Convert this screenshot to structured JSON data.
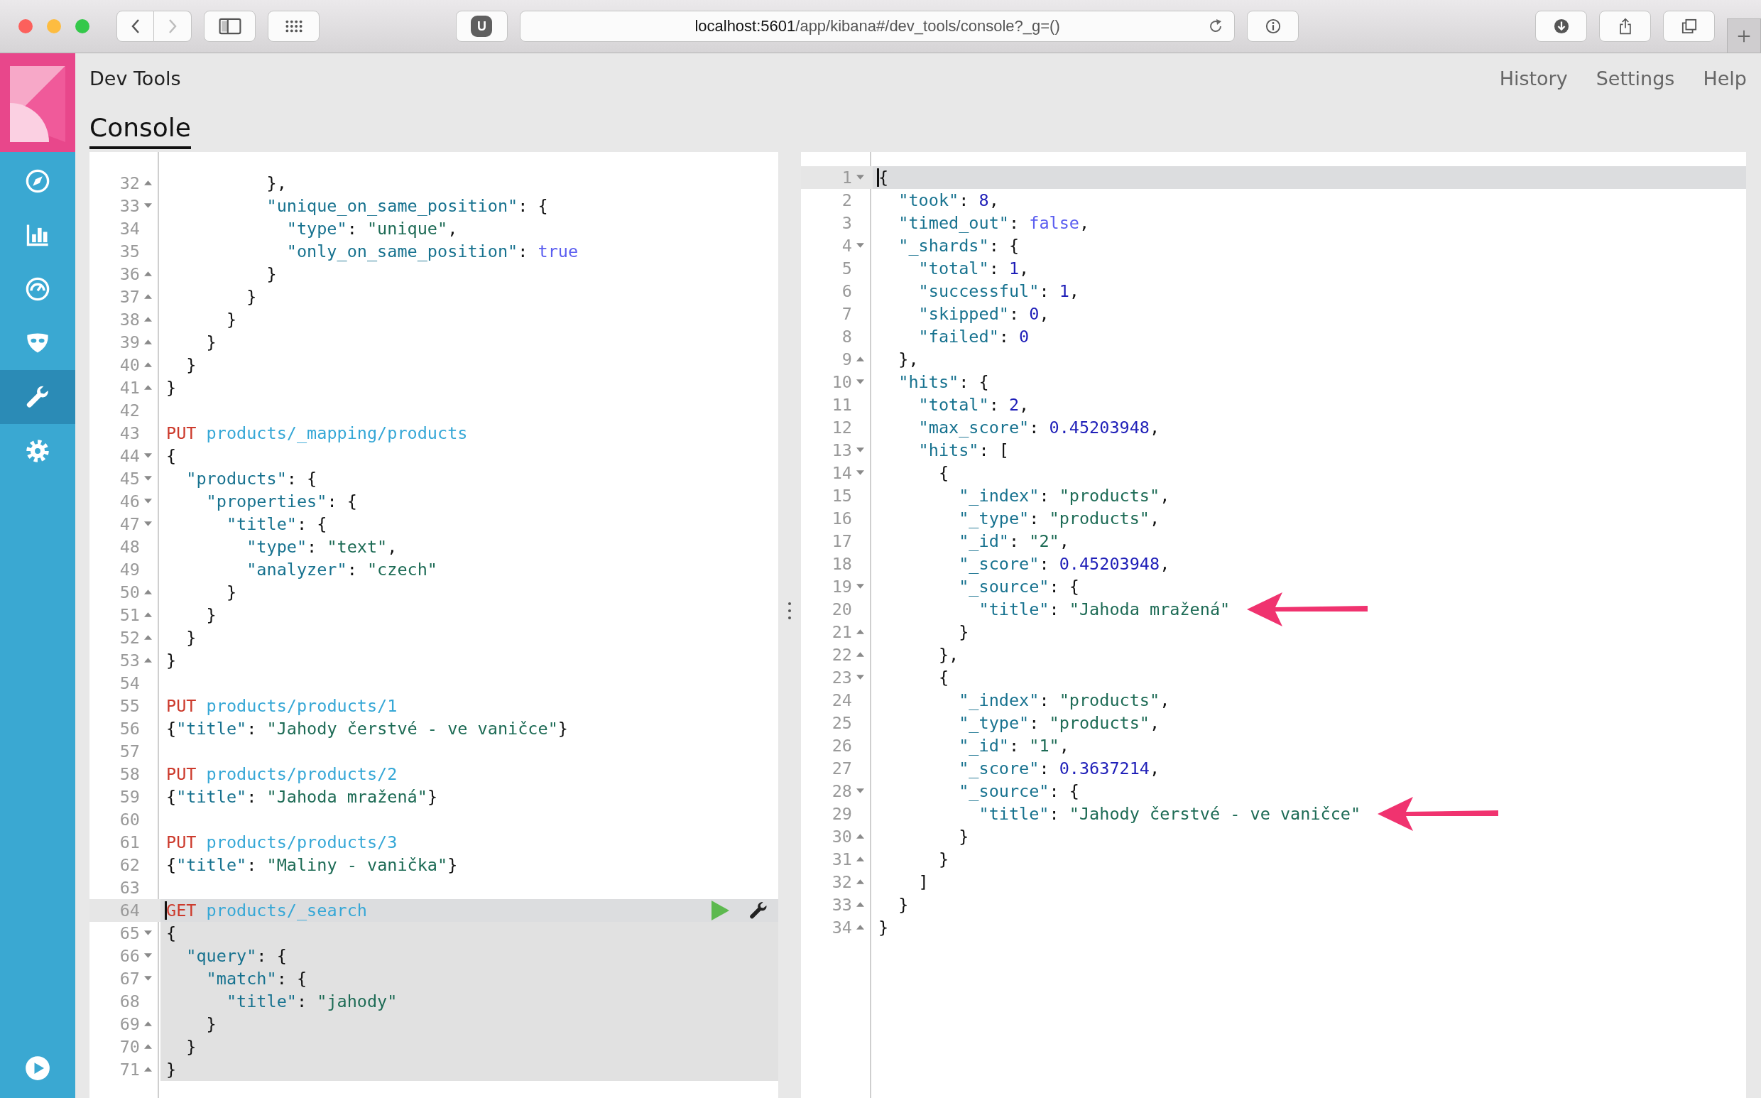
{
  "browser": {
    "back_disabled": false,
    "forward_disabled": true,
    "extension_badge": "U",
    "url_host": "localhost:5601",
    "url_path": "/app/kibana#/dev_tools/console?_g=()"
  },
  "sidebar": {
    "items": [
      {
        "kind": "compass",
        "selected": false
      },
      {
        "kind": "chart",
        "selected": false
      },
      {
        "kind": "gauge",
        "selected": false
      },
      {
        "kind": "mask",
        "selected": false
      },
      {
        "kind": "wrench",
        "selected": true
      },
      {
        "kind": "gear",
        "selected": false
      }
    ],
    "footer_item": {
      "kind": "play"
    }
  },
  "header": {
    "title": "Dev Tools",
    "links": [
      "History",
      "Settings",
      "Help"
    ]
  },
  "tabs": [
    {
      "label": "Console",
      "selected": true
    }
  ],
  "request_editor": {
    "lines": [
      {
        "number": "32",
        "kind": "fold_end",
        "selected": false,
        "in_request": false,
        "tokens": [
          {
            "kind": "punct",
            "text": "          },"
          }
        ]
      },
      {
        "number": "33",
        "kind": "fold_start",
        "selected": false,
        "in_request": false,
        "tokens": [
          {
            "kind": "key",
            "text": "          \"unique_on_same_position\""
          },
          {
            "kind": "punct",
            "text": ": {"
          }
        ]
      },
      {
        "number": "34",
        "kind": "plain",
        "selected": false,
        "in_request": false,
        "tokens": [
          {
            "kind": "key",
            "text": "            \"type\""
          },
          {
            "kind": "punct",
            "text": ": "
          },
          {
            "kind": "string",
            "text": "\"unique\""
          },
          {
            "kind": "punct",
            "text": ","
          }
        ]
      },
      {
        "number": "35",
        "kind": "plain",
        "selected": false,
        "in_request": false,
        "tokens": [
          {
            "kind": "key",
            "text": "            \"only_on_same_position\""
          },
          {
            "kind": "punct",
            "text": ": "
          },
          {
            "kind": "literal",
            "text": "true"
          }
        ]
      },
      {
        "number": "36",
        "kind": "fold_end",
        "selected": false,
        "in_request": false,
        "tokens": [
          {
            "kind": "punct",
            "text": "          }"
          }
        ]
      },
      {
        "number": "37",
        "kind": "fold_end",
        "selected": false,
        "in_request": false,
        "tokens": [
          {
            "kind": "punct",
            "text": "        }"
          }
        ]
      },
      {
        "number": "38",
        "kind": "fold_end",
        "selected": false,
        "in_request": false,
        "tokens": [
          {
            "kind": "punct",
            "text": "      }"
          }
        ]
      },
      {
        "number": "39",
        "kind": "fold_end",
        "selected": false,
        "in_request": false,
        "tokens": [
          {
            "kind": "punct",
            "text": "    }"
          }
        ]
      },
      {
        "number": "40",
        "kind": "fold_end",
        "selected": false,
        "in_request": false,
        "tokens": [
          {
            "kind": "punct",
            "text": "  }"
          }
        ]
      },
      {
        "number": "41",
        "kind": "fold_end",
        "selected": false,
        "in_request": false,
        "tokens": [
          {
            "kind": "punct",
            "text": "}"
          }
        ]
      },
      {
        "number": "42",
        "kind": "plain",
        "selected": false,
        "in_request": false
      },
      {
        "number": "43",
        "kind": "plain",
        "selected": false,
        "in_request": false,
        "tokens": [
          {
            "kind": "method",
            "text": "PUT"
          },
          {
            "kind": "path",
            "text": " products/_mapping/products"
          }
        ]
      },
      {
        "number": "44",
        "kind": "fold_start",
        "selected": false,
        "in_request": false,
        "tokens": [
          {
            "kind": "punct",
            "text": "{"
          }
        ]
      },
      {
        "number": "45",
        "kind": "fold_start",
        "selected": false,
        "in_request": false,
        "tokens": [
          {
            "kind": "key",
            "text": "  \"products\""
          },
          {
            "kind": "punct",
            "text": ": {"
          }
        ]
      },
      {
        "number": "46",
        "kind": "fold_start",
        "selected": false,
        "in_request": false,
        "tokens": [
          {
            "kind": "key",
            "text": "    \"properties\""
          },
          {
            "kind": "punct",
            "text": ": {"
          }
        ]
      },
      {
        "number": "47",
        "kind": "fold_start",
        "selected": false,
        "in_request": false,
        "tokens": [
          {
            "kind": "key",
            "text": "      \"title\""
          },
          {
            "kind": "punct",
            "text": ": {"
          }
        ]
      },
      {
        "number": "48",
        "kind": "plain",
        "selected": false,
        "in_request": false,
        "tokens": [
          {
            "kind": "key",
            "text": "        \"type\""
          },
          {
            "kind": "punct",
            "text": ": "
          },
          {
            "kind": "string",
            "text": "\"text\""
          },
          {
            "kind": "punct",
            "text": ","
          }
        ]
      },
      {
        "number": "49",
        "kind": "plain",
        "selected": false,
        "in_request": false,
        "tokens": [
          {
            "kind": "key",
            "text": "        \"analyzer\""
          },
          {
            "kind": "punct",
            "text": ": "
          },
          {
            "kind": "string",
            "text": "\"czech\""
          }
        ]
      },
      {
        "number": "50",
        "kind": "fold_end",
        "selected": false,
        "in_request": false,
        "tokens": [
          {
            "kind": "punct",
            "text": "      }"
          }
        ]
      },
      {
        "number": "51",
        "kind": "fold_end",
        "selected": false,
        "in_request": false,
        "tokens": [
          {
            "kind": "punct",
            "text": "    }"
          }
        ]
      },
      {
        "number": "52",
        "kind": "fold_end",
        "selected": false,
        "in_request": false,
        "tokens": [
          {
            "kind": "punct",
            "text": "  }"
          }
        ]
      },
      {
        "number": "53",
        "kind": "fold_end",
        "selected": false,
        "in_request": false,
        "tokens": [
          {
            "kind": "punct",
            "text": "}"
          }
        ]
      },
      {
        "number": "54",
        "kind": "plain",
        "selected": false,
        "in_request": false
      },
      {
        "number": "55",
        "kind": "plain",
        "selected": false,
        "in_request": false,
        "tokens": [
          {
            "kind": "method",
            "text": "PUT"
          },
          {
            "kind": "path",
            "text": " products/products/1"
          }
        ]
      },
      {
        "number": "56",
        "kind": "plain",
        "selected": false,
        "in_request": false,
        "tokens": [
          {
            "kind": "punct",
            "text": "{"
          },
          {
            "kind": "key",
            "text": "\"title\""
          },
          {
            "kind": "punct",
            "text": ": "
          },
          {
            "kind": "string",
            "text": "\"Jahody čerstvé - ve vaničce\""
          },
          {
            "kind": "punct",
            "text": "}"
          }
        ]
      },
      {
        "number": "57",
        "kind": "plain",
        "selected": false,
        "in_request": false
      },
      {
        "number": "58",
        "kind": "plain",
        "selected": false,
        "in_request": false,
        "tokens": [
          {
            "kind": "method",
            "text": "PUT"
          },
          {
            "kind": "path",
            "text": " products/products/2"
          }
        ]
      },
      {
        "number": "59",
        "kind": "plain",
        "selected": false,
        "in_request": false,
        "tokens": [
          {
            "kind": "punct",
            "text": "{"
          },
          {
            "kind": "key",
            "text": "\"title\""
          },
          {
            "kind": "punct",
            "text": ": "
          },
          {
            "kind": "string",
            "text": "\"Jahoda mražená\""
          },
          {
            "kind": "punct",
            "text": "}"
          }
        ]
      },
      {
        "number": "60",
        "kind": "plain",
        "selected": false,
        "in_request": false
      },
      {
        "number": "61",
        "kind": "plain",
        "selected": false,
        "in_request": false,
        "tokens": [
          {
            "kind": "method",
            "text": "PUT"
          },
          {
            "kind": "path",
            "text": " products/products/3"
          }
        ]
      },
      {
        "number": "62",
        "kind": "plain",
        "selected": false,
        "in_request": false,
        "tokens": [
          {
            "kind": "punct",
            "text": "{"
          },
          {
            "kind": "key",
            "text": "\"title\""
          },
          {
            "kind": "punct",
            "text": ": "
          },
          {
            "kind": "string",
            "text": "\"Maliny - vanička\""
          },
          {
            "kind": "punct",
            "text": "}"
          }
        ]
      },
      {
        "number": "63",
        "kind": "plain",
        "selected": false,
        "in_request": false
      },
      {
        "number": "64",
        "kind": "plain",
        "selected": true,
        "in_request": true,
        "tokens": [
          {
            "kind": "method",
            "text": "GET"
          },
          {
            "kind": "path",
            "text": " products/_search"
          }
        ]
      },
      {
        "number": "65",
        "kind": "fold_start",
        "selected": false,
        "in_request": true,
        "tokens": [
          {
            "kind": "punct",
            "text": "{"
          }
        ]
      },
      {
        "number": "66",
        "kind": "fold_start",
        "selected": false,
        "in_request": true,
        "tokens": [
          {
            "kind": "key",
            "text": "  \"query\""
          },
          {
            "kind": "punct",
            "text": ": {"
          }
        ]
      },
      {
        "number": "67",
        "kind": "fold_start",
        "selected": false,
        "in_request": true,
        "tokens": [
          {
            "kind": "key",
            "text": "    \"match\""
          },
          {
            "kind": "punct",
            "text": ": {"
          }
        ]
      },
      {
        "number": "68",
        "kind": "plain",
        "selected": false,
        "in_request": true,
        "tokens": [
          {
            "kind": "key",
            "text": "      \"title\""
          },
          {
            "kind": "punct",
            "text": ": "
          },
          {
            "kind": "string",
            "text": "\"jahody\""
          }
        ]
      },
      {
        "number": "69",
        "kind": "fold_end",
        "selected": false,
        "in_request": true,
        "tokens": [
          {
            "kind": "punct",
            "text": "    }"
          }
        ]
      },
      {
        "number": "70",
        "kind": "fold_end",
        "selected": false,
        "in_request": true,
        "tokens": [
          {
            "kind": "punct",
            "text": "  }"
          }
        ]
      },
      {
        "number": "71",
        "kind": "fold_end",
        "selected": false,
        "in_request": true,
        "tokens": [
          {
            "kind": "punct",
            "text": "}"
          }
        ]
      }
    ]
  },
  "response_editor": {
    "lines": [
      {
        "number": "1",
        "kind": "fold_start",
        "selected": true,
        "marked": false,
        "tokens": [
          {
            "kind": "punct",
            "text": "{"
          }
        ]
      },
      {
        "number": "2",
        "kind": "plain",
        "selected": false,
        "marked": false,
        "tokens": [
          {
            "kind": "key",
            "text": "  \"took\""
          },
          {
            "kind": "punct",
            "text": ": "
          },
          {
            "kind": "number",
            "text": "8"
          },
          {
            "kind": "punct",
            "text": ","
          }
        ]
      },
      {
        "number": "3",
        "kind": "plain",
        "selected": false,
        "marked": false,
        "tokens": [
          {
            "kind": "key",
            "text": "  \"timed_out\""
          },
          {
            "kind": "punct",
            "text": ": "
          },
          {
            "kind": "literal",
            "text": "false"
          },
          {
            "kind": "punct",
            "text": ","
          }
        ]
      },
      {
        "number": "4",
        "kind": "fold_start",
        "selected": false,
        "marked": false,
        "tokens": [
          {
            "kind": "key",
            "text": "  \"_shards\""
          },
          {
            "kind": "punct",
            "text": ": {"
          }
        ]
      },
      {
        "number": "5",
        "kind": "plain",
        "selected": false,
        "marked": false,
        "tokens": [
          {
            "kind": "key",
            "text": "    \"total\""
          },
          {
            "kind": "punct",
            "text": ": "
          },
          {
            "kind": "number",
            "text": "1"
          },
          {
            "kind": "punct",
            "text": ","
          }
        ]
      },
      {
        "number": "6",
        "kind": "plain",
        "selected": false,
        "marked": false,
        "tokens": [
          {
            "kind": "key",
            "text": "    \"successful\""
          },
          {
            "kind": "punct",
            "text": ": "
          },
          {
            "kind": "number",
            "text": "1"
          },
          {
            "kind": "punct",
            "text": ","
          }
        ]
      },
      {
        "number": "7",
        "kind": "plain",
        "selected": false,
        "marked": false,
        "tokens": [
          {
            "kind": "key",
            "text": "    \"skipped\""
          },
          {
            "kind": "punct",
            "text": ": "
          },
          {
            "kind": "number",
            "text": "0"
          },
          {
            "kind": "punct",
            "text": ","
          }
        ]
      },
      {
        "number": "8",
        "kind": "plain",
        "selected": false,
        "marked": false,
        "tokens": [
          {
            "kind": "key",
            "text": "    \"failed\""
          },
          {
            "kind": "punct",
            "text": ": "
          },
          {
            "kind": "number",
            "text": "0"
          }
        ]
      },
      {
        "number": "9",
        "kind": "fold_end",
        "selected": false,
        "marked": false,
        "tokens": [
          {
            "kind": "punct",
            "text": "  },"
          }
        ]
      },
      {
        "number": "10",
        "kind": "fold_start",
        "selected": false,
        "marked": false,
        "tokens": [
          {
            "kind": "key",
            "text": "  \"hits\""
          },
          {
            "kind": "punct",
            "text": ": {"
          }
        ]
      },
      {
        "number": "11",
        "kind": "plain",
        "selected": false,
        "marked": false,
        "tokens": [
          {
            "kind": "key",
            "text": "    \"total\""
          },
          {
            "kind": "punct",
            "text": ": "
          },
          {
            "kind": "number",
            "text": "2"
          },
          {
            "kind": "punct",
            "text": ","
          }
        ]
      },
      {
        "number": "12",
        "kind": "plain",
        "selected": false,
        "marked": false,
        "tokens": [
          {
            "kind": "key",
            "text": "    \"max_score\""
          },
          {
            "kind": "punct",
            "text": ": "
          },
          {
            "kind": "number",
            "text": "0.45203948"
          },
          {
            "kind": "punct",
            "text": ","
          }
        ]
      },
      {
        "number": "13",
        "kind": "fold_start",
        "selected": false,
        "marked": false,
        "tokens": [
          {
            "kind": "key",
            "text": "    \"hits\""
          },
          {
            "kind": "punct",
            "text": ": ["
          }
        ]
      },
      {
        "number": "14",
        "kind": "fold_start",
        "selected": false,
        "marked": false,
        "tokens": [
          {
            "kind": "punct",
            "text": "      {"
          }
        ]
      },
      {
        "number": "15",
        "kind": "plain",
        "selected": false,
        "marked": false,
        "tokens": [
          {
            "kind": "key",
            "text": "        \"_index\""
          },
          {
            "kind": "punct",
            "text": ": "
          },
          {
            "kind": "string",
            "text": "\"products\""
          },
          {
            "kind": "punct",
            "text": ","
          }
        ]
      },
      {
        "number": "16",
        "kind": "plain",
        "selected": false,
        "marked": false,
        "tokens": [
          {
            "kind": "key",
            "text": "        \"_type\""
          },
          {
            "kind": "punct",
            "text": ": "
          },
          {
            "kind": "string",
            "text": "\"products\""
          },
          {
            "kind": "punct",
            "text": ","
          }
        ]
      },
      {
        "number": "17",
        "kind": "plain",
        "selected": false,
        "marked": false,
        "tokens": [
          {
            "kind": "key",
            "text": "        \"_id\""
          },
          {
            "kind": "punct",
            "text": ": "
          },
          {
            "kind": "string",
            "text": "\"2\""
          },
          {
            "kind": "punct",
            "text": ","
          }
        ]
      },
      {
        "number": "18",
        "kind": "plain",
        "selected": false,
        "marked": false,
        "tokens": [
          {
            "kind": "key",
            "text": "        \"_score\""
          },
          {
            "kind": "punct",
            "text": ": "
          },
          {
            "kind": "number",
            "text": "0.45203948"
          },
          {
            "kind": "punct",
            "text": ","
          }
        ]
      },
      {
        "number": "19",
        "kind": "fold_start",
        "selected": false,
        "marked": false,
        "tokens": [
          {
            "kind": "key",
            "text": "        \"_source\""
          },
          {
            "kind": "punct",
            "text": ": {"
          }
        ]
      },
      {
        "number": "20",
        "kind": "plain",
        "selected": false,
        "marked": true,
        "tokens": [
          {
            "kind": "key",
            "text": "          \"title\""
          },
          {
            "kind": "punct",
            "text": ": "
          },
          {
            "kind": "string",
            "text": "\"Jahoda mražená\""
          }
        ]
      },
      {
        "number": "21",
        "kind": "fold_end",
        "selected": false,
        "marked": false,
        "tokens": [
          {
            "kind": "punct",
            "text": "        }"
          }
        ]
      },
      {
        "number": "22",
        "kind": "fold_end",
        "selected": false,
        "marked": false,
        "tokens": [
          {
            "kind": "punct",
            "text": "      },"
          }
        ]
      },
      {
        "number": "23",
        "kind": "fold_start",
        "selected": false,
        "marked": false,
        "tokens": [
          {
            "kind": "punct",
            "text": "      {"
          }
        ]
      },
      {
        "number": "24",
        "kind": "plain",
        "selected": false,
        "marked": false,
        "tokens": [
          {
            "kind": "key",
            "text": "        \"_index\""
          },
          {
            "kind": "punct",
            "text": ": "
          },
          {
            "kind": "string",
            "text": "\"products\""
          },
          {
            "kind": "punct",
            "text": ","
          }
        ]
      },
      {
        "number": "25",
        "kind": "plain",
        "selected": false,
        "marked": false,
        "tokens": [
          {
            "kind": "key",
            "text": "        \"_type\""
          },
          {
            "kind": "punct",
            "text": ": "
          },
          {
            "kind": "string",
            "text": "\"products\""
          },
          {
            "kind": "punct",
            "text": ","
          }
        ]
      },
      {
        "number": "26",
        "kind": "plain",
        "selected": false,
        "marked": false,
        "tokens": [
          {
            "kind": "key",
            "text": "        \"_id\""
          },
          {
            "kind": "punct",
            "text": ": "
          },
          {
            "kind": "string",
            "text": "\"1\""
          },
          {
            "kind": "punct",
            "text": ","
          }
        ]
      },
      {
        "number": "27",
        "kind": "plain",
        "selected": false,
        "marked": false,
        "tokens": [
          {
            "kind": "key",
            "text": "        \"_score\""
          },
          {
            "kind": "punct",
            "text": ": "
          },
          {
            "kind": "number",
            "text": "0.3637214"
          },
          {
            "kind": "punct",
            "text": ","
          }
        ]
      },
      {
        "number": "28",
        "kind": "fold_start",
        "selected": false,
        "marked": false,
        "tokens": [
          {
            "kind": "key",
            "text": "        \"_source\""
          },
          {
            "kind": "punct",
            "text": ": {"
          }
        ]
      },
      {
        "number": "29",
        "kind": "plain",
        "selected": false,
        "marked": true,
        "tokens": [
          {
            "kind": "key",
            "text": "          \"title\""
          },
          {
            "kind": "punct",
            "text": ": "
          },
          {
            "kind": "string",
            "text": "\"Jahody čerstvé - ve vaničce\""
          }
        ]
      },
      {
        "number": "30",
        "kind": "fold_end",
        "selected": false,
        "marked": false,
        "tokens": [
          {
            "kind": "punct",
            "text": "        }"
          }
        ]
      },
      {
        "number": "31",
        "kind": "fold_end",
        "selected": false,
        "marked": false,
        "tokens": [
          {
            "kind": "punct",
            "text": "      }"
          }
        ]
      },
      {
        "number": "32",
        "kind": "fold_end",
        "selected": false,
        "marked": false,
        "tokens": [
          {
            "kind": "punct",
            "text": "    ]"
          }
        ]
      },
      {
        "number": "33",
        "kind": "fold_end",
        "selected": false,
        "marked": false,
        "tokens": [
          {
            "kind": "punct",
            "text": "  }"
          }
        ]
      },
      {
        "number": "34",
        "kind": "fold_end",
        "selected": false,
        "marked": false,
        "tokens": [
          {
            "kind": "punct",
            "text": "}"
          }
        ]
      }
    ]
  }
}
